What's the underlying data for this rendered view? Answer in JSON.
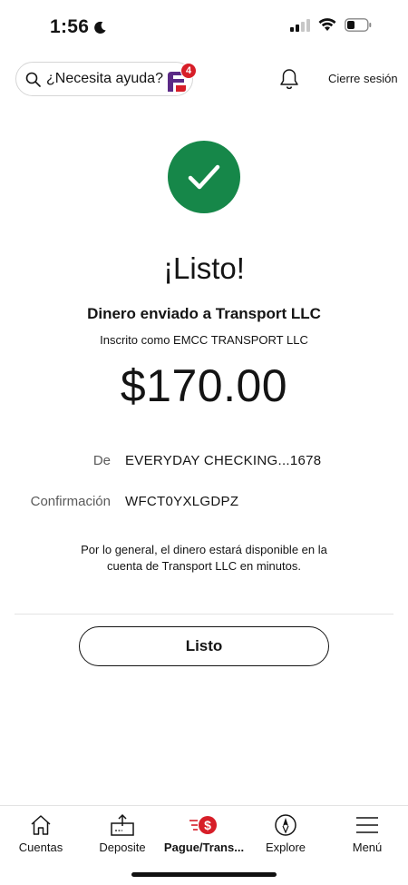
{
  "status_bar": {
    "time": "1:56",
    "icons": [
      "moon-icon",
      "signal-icon",
      "wifi-icon",
      "battery-icon"
    ]
  },
  "header": {
    "search_placeholder": "¿Necesita ayuda?",
    "assistant_badge_count": "4",
    "logout_label": "Cierre sesión"
  },
  "confirmation": {
    "title": "¡Listo!",
    "sent_to": "Dinero enviado a Transport LLC",
    "enrolled_as": "Inscrito como EMCC TRANSPORT LLC",
    "amount": "$170.00",
    "from_label": "De",
    "from_value": "EVERYDAY CHECKING...1678",
    "confirmation_label": "Confirmación",
    "confirmation_value": "WFCT0YXLGDPZ",
    "note": "Por lo general, el dinero estará disponible en la cuenta de Transport LLC en minutos.",
    "done_label": "Listo"
  },
  "bottom_nav": {
    "items": [
      {
        "label": "Cuentas",
        "icon": "home-icon"
      },
      {
        "label": "Deposite",
        "icon": "deposit-icon"
      },
      {
        "label": "Pague/Trans...",
        "icon": "pay-transfer-icon",
        "active": true
      },
      {
        "label": "Explore",
        "icon": "compass-icon"
      },
      {
        "label": "Menú",
        "icon": "menu-icon"
      }
    ]
  },
  "colors": {
    "success_green": "#168749",
    "brand_red": "#d71e28",
    "assistant_purple": "#5b2a86"
  }
}
